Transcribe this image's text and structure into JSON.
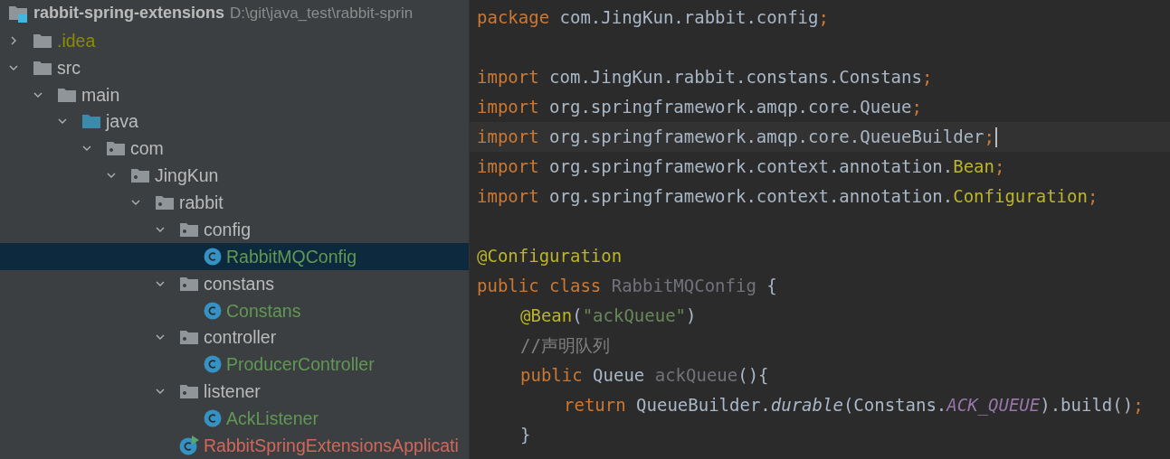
{
  "project": {
    "name": "rabbit-spring-extensions",
    "path": "D:\\git\\java_test\\rabbit-sprin"
  },
  "tree": [
    {
      "label": ".idea",
      "kind": "folder",
      "color": "#8c8c00",
      "expanded": false,
      "selected": false
    },
    {
      "label": "src",
      "kind": "folder",
      "color": "#bbbbbb",
      "expanded": true,
      "selected": false,
      "children": [
        {
          "label": "main",
          "kind": "folder",
          "color": "#bbbbbb",
          "expanded": true,
          "selected": false,
          "children": [
            {
              "label": "java",
              "kind": "source_root",
              "color": "#bbbbbb",
              "expanded": true,
              "selected": false,
              "children": [
                {
                  "label": "com",
                  "kind": "package",
                  "color": "#bbbbbb",
                  "expanded": true,
                  "selected": false,
                  "children": [
                    {
                      "label": "JingKun",
                      "kind": "package",
                      "color": "#bbbbbb",
                      "expanded": true,
                      "selected": false,
                      "children": [
                        {
                          "label": "rabbit",
                          "kind": "package",
                          "color": "#bbbbbb",
                          "expanded": true,
                          "selected": false,
                          "children": [
                            {
                              "label": "config",
                              "kind": "package",
                              "color": "#bbbbbb",
                              "expanded": true,
                              "selected": false,
                              "children": [
                                {
                                  "label": "RabbitMQConfig",
                                  "kind": "class",
                                  "color": "#629755",
                                  "selected": true
                                }
                              ]
                            },
                            {
                              "label": "constans",
                              "kind": "package",
                              "color": "#bbbbbb",
                              "expanded": true,
                              "selected": false,
                              "children": [
                                {
                                  "label": "Constans",
                                  "kind": "class",
                                  "color": "#629755",
                                  "selected": false
                                }
                              ]
                            },
                            {
                              "label": "controller",
                              "kind": "package",
                              "color": "#bbbbbb",
                              "expanded": true,
                              "selected": false,
                              "children": [
                                {
                                  "label": "ProducerController",
                                  "kind": "class",
                                  "color": "#629755",
                                  "selected": false
                                }
                              ]
                            },
                            {
                              "label": "listener",
                              "kind": "package",
                              "color": "#bbbbbb",
                              "expanded": true,
                              "selected": false,
                              "children": [
                                {
                                  "label": "AckListener",
                                  "kind": "class",
                                  "color": "#629755",
                                  "selected": false
                                }
                              ]
                            },
                            {
                              "label": "RabbitSpringExtensionsApplicati",
                              "kind": "app_class",
                              "color": "#d1675a",
                              "selected": false
                            }
                          ]
                        }
                      ]
                    }
                  ]
                }
              ]
            }
          ]
        }
      ]
    }
  ],
  "editor": {
    "lines": [
      {
        "current": false,
        "tokens": [
          {
            "kind": "keyword",
            "text": "package"
          },
          {
            "kind": "plain",
            "text": " com.JingKun.rabbit.config"
          },
          {
            "kind": "keyword",
            "text": ";"
          }
        ]
      },
      {
        "current": false
      },
      {
        "current": false,
        "tokens": [
          {
            "kind": "keyword",
            "text": "import"
          },
          {
            "kind": "plain",
            "text": " com.JingKun.rabbit.constans.Constans"
          },
          {
            "kind": "keyword",
            "text": ";"
          }
        ]
      },
      {
        "current": false,
        "tokens": [
          {
            "kind": "keyword",
            "text": "import"
          },
          {
            "kind": "plain",
            "text": " org.springframework.amqp.core.Queue"
          },
          {
            "kind": "keyword",
            "text": ";"
          }
        ]
      },
      {
        "current": true,
        "tokens": [
          {
            "kind": "keyword",
            "text": "import"
          },
          {
            "kind": "plain",
            "text": " org.springframework.amqp.core.QueueBuilder"
          },
          {
            "kind": "keyword",
            "text": ";"
          }
        ]
      },
      {
        "current": false,
        "tokens": [
          {
            "kind": "keyword",
            "text": "import"
          },
          {
            "kind": "plain",
            "text": " org.springframework.context.annotation."
          },
          {
            "kind": "annotation",
            "text": "Bean"
          },
          {
            "kind": "keyword",
            "text": ";"
          }
        ]
      },
      {
        "current": false,
        "tokens": [
          {
            "kind": "keyword",
            "text": "import"
          },
          {
            "kind": "plain",
            "text": " org.springframework.context.annotation."
          },
          {
            "kind": "annotation",
            "text": "Configuration"
          },
          {
            "kind": "keyword",
            "text": ";"
          }
        ]
      },
      {
        "current": false
      },
      {
        "current": false,
        "tokens": [
          {
            "kind": "annotation",
            "text": "@Configuration"
          }
        ]
      },
      {
        "current": false,
        "tokens": [
          {
            "kind": "keyword",
            "text": "public class "
          },
          {
            "kind": "unused",
            "text": "RabbitMQConfig"
          },
          {
            "kind": "plain",
            "text": " {"
          }
        ],
        "children": [
          {
            "current": false,
            "tokens": [
              {
                "kind": "annotation",
                "text": "@Bean"
              },
              {
                "kind": "plain",
                "text": "("
              },
              {
                "kind": "string",
                "text": "\"ackQueue\""
              },
              {
                "kind": "plain",
                "text": ")"
              }
            ]
          },
          {
            "current": false,
            "tokens": [
              {
                "kind": "comment",
                "text": "//声明队列"
              }
            ]
          },
          {
            "current": false,
            "tokens": [
              {
                "kind": "keyword",
                "text": "public "
              },
              {
                "kind": "plain",
                "text": "Queue "
              },
              {
                "kind": "unused",
                "text": "ackQueue"
              },
              {
                "kind": "plain",
                "text": "(){"
              }
            ],
            "children": [
              {
                "current": false,
                "tokens": [
                  {
                    "kind": "keyword",
                    "text": "return "
                  },
                  {
                    "kind": "plain",
                    "text": "QueueBuilder."
                  },
                  {
                    "kind": "static_call",
                    "text": "durable"
                  },
                  {
                    "kind": "plain",
                    "text": "(Constans."
                  },
                  {
                    "kind": "constant",
                    "text": "ACK_QUEUE"
                  },
                  {
                    "kind": "plain",
                    "text": ").build()"
                  },
                  {
                    "kind": "keyword",
                    "text": ";"
                  }
                ]
              }
            ]
          },
          {
            "current": false,
            "tokens": [
              {
                "kind": "plain",
                "text": "}"
              }
            ]
          }
        ]
      }
    ]
  }
}
